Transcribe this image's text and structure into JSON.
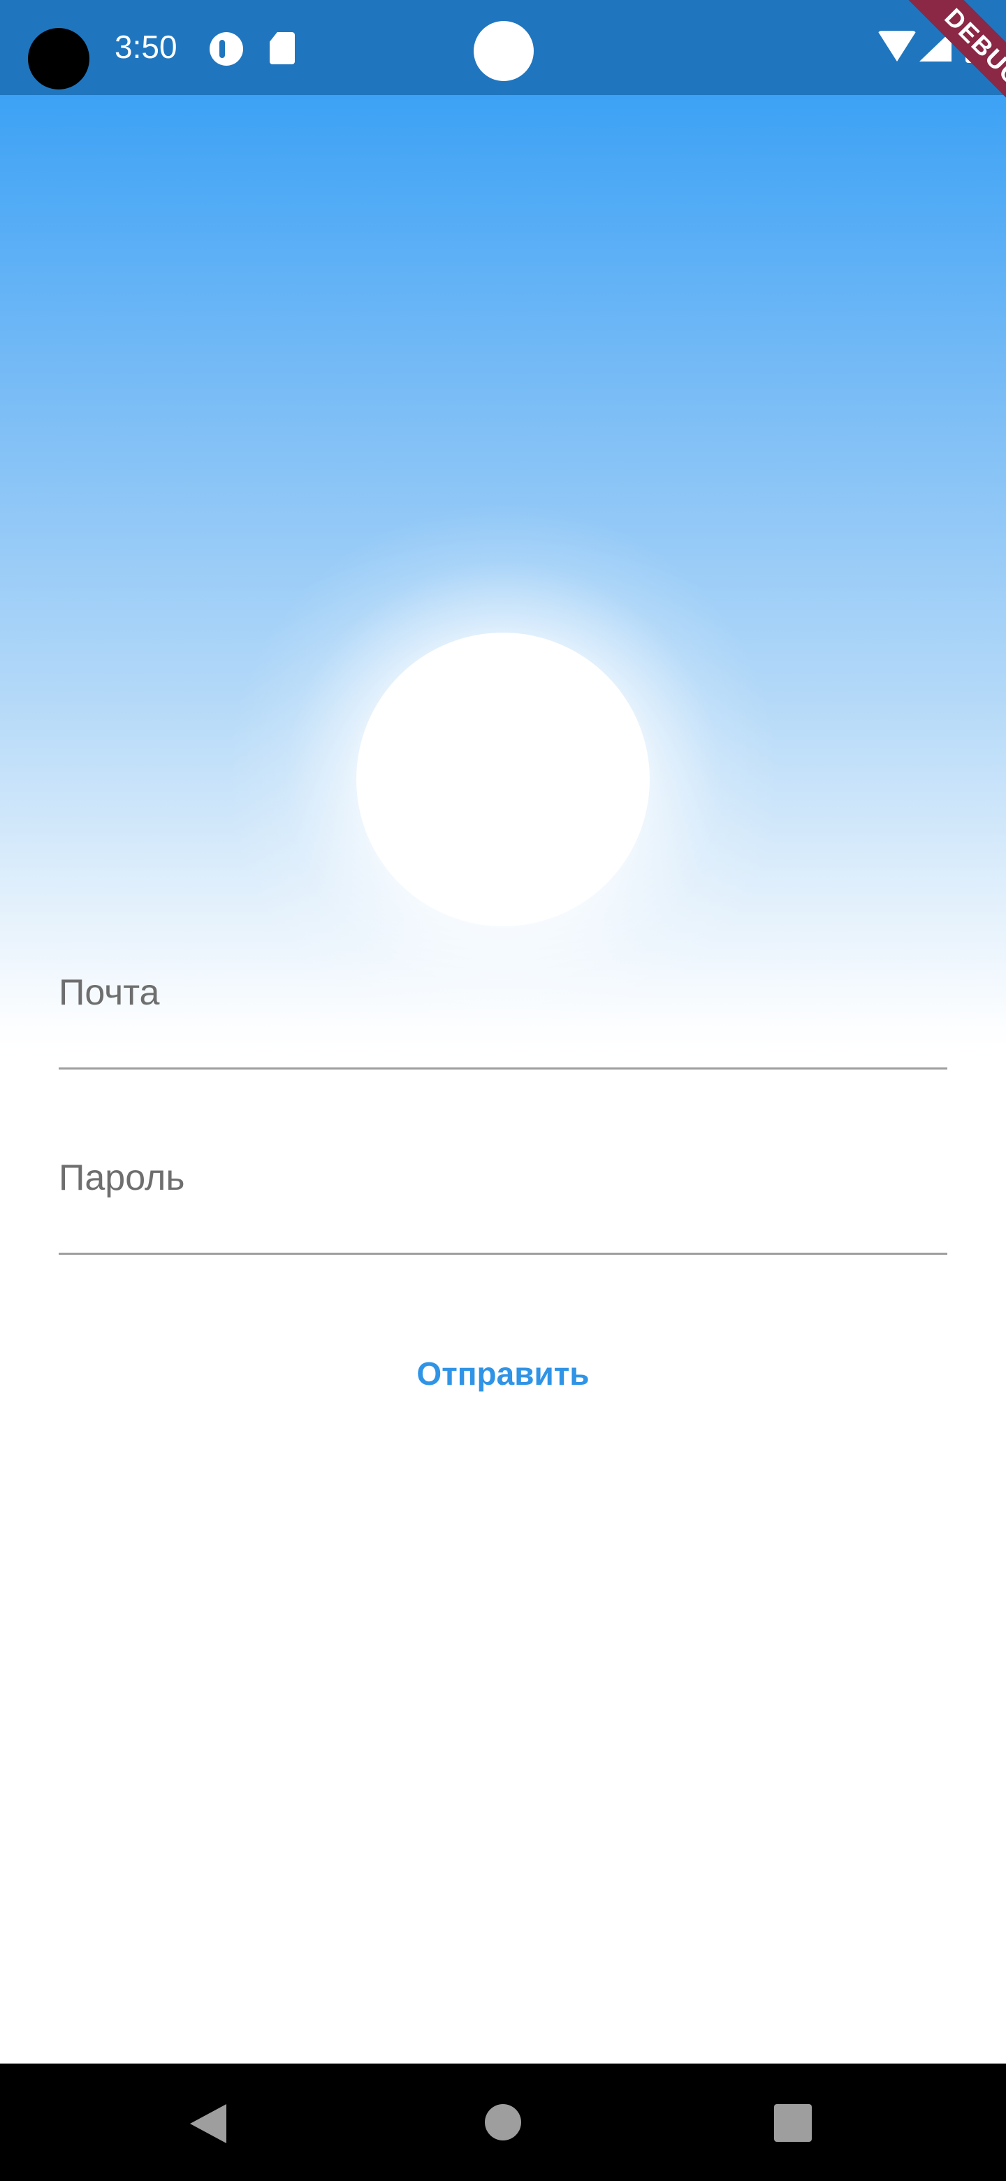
{
  "status_bar": {
    "time": "3:50",
    "icons": [
      "camera-cutout",
      "app-notification-icon",
      "sd-card-icon",
      "wifi-icon",
      "signal-icon",
      "battery-icon"
    ]
  },
  "debug_banner": "DEBUG",
  "form": {
    "email_label": "Почта",
    "password_label": "Пароль",
    "submit_label": "Отправить"
  },
  "colors": {
    "status_bar": "#1f76bf",
    "sky_top": "#3aa1f5",
    "accent": "#2f94e6",
    "debug_banner": "#8b2846"
  },
  "nav_bar": {
    "buttons": [
      "back",
      "home",
      "recents"
    ]
  }
}
